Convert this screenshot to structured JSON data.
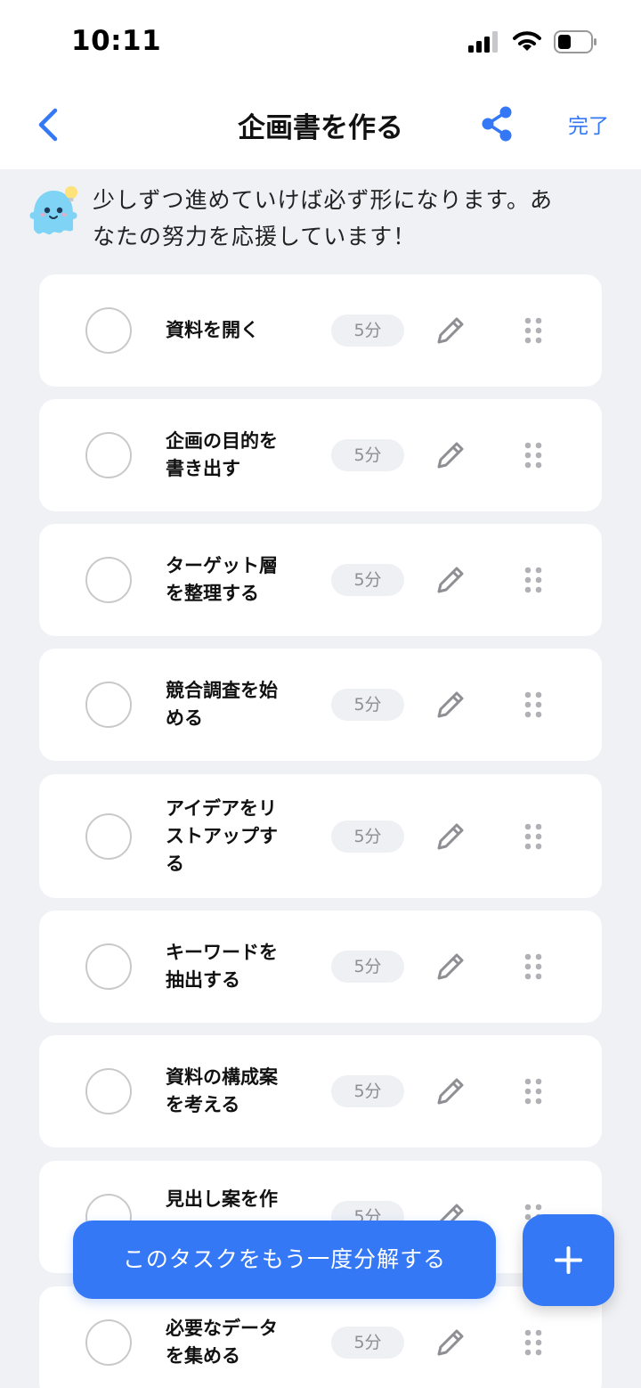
{
  "status_bar": {
    "time": "10:11"
  },
  "nav": {
    "title": "企画書を作る",
    "done_label": "完了"
  },
  "encouragement": {
    "line1": "少しずつ進めていけば必ず形になります。あ",
    "line2": "なたの努力を応援しています！"
  },
  "tasks": [
    {
      "line1": "資料を開く",
      "line2": "",
      "line3": "",
      "time": "5分",
      "done": false
    },
    {
      "line1": "企画の目的を",
      "line2": "書き出す",
      "line3": "",
      "time": "5分",
      "done": false
    },
    {
      "line1": "ターゲット層",
      "line2": "を整理する",
      "line3": "",
      "time": "5分",
      "done": false
    },
    {
      "line1": "競合調査を始",
      "line2": "める",
      "line3": "",
      "time": "5分",
      "done": false
    },
    {
      "line1": "アイデアをリ",
      "line2": "ストアップす",
      "line3": "る",
      "time": "5分",
      "done": false
    },
    {
      "line1": "キーワードを",
      "line2": "抽出する",
      "line3": "",
      "time": "5分",
      "done": false
    },
    {
      "line1": "資料の構成案",
      "line2": "を考える",
      "line3": "",
      "time": "5分",
      "done": false
    },
    {
      "line1": "見出し案を作",
      "line2": "",
      "line3": "",
      "time": "5分",
      "done": false
    },
    {
      "line1": "必要なデータ",
      "line2": "を集める",
      "line3": "",
      "time": "5分",
      "done": false
    }
  ],
  "actions": {
    "redo_label": "このタスクをもう一度分解する"
  },
  "icons": {
    "back": "chevron-left-icon",
    "share": "share-icon",
    "mascot": "ghost-mascot-icon",
    "edit": "pencil-icon",
    "drag": "drag-handle-icon",
    "add": "plus-icon"
  },
  "colors": {
    "accent": "#3478f6",
    "background": "#eff1f5",
    "card": "#ffffff",
    "muted": "#8e8e93"
  }
}
